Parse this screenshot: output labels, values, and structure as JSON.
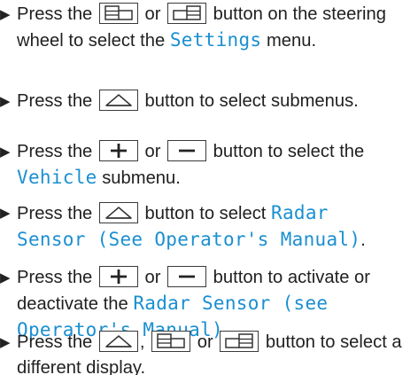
{
  "bullet_glyph": "▶",
  "accent_color": "#1a8fd1",
  "steps": [
    [
      {
        "t": "text",
        "v": "Press the "
      },
      {
        "t": "key",
        "icon": "display-back-icon"
      },
      {
        "t": "text",
        "v": " or "
      },
      {
        "t": "key",
        "icon": "display-forward-icon"
      },
      {
        "t": "text",
        "v": " button on the steering wheel to select the "
      },
      {
        "t": "mono",
        "v": "Settings"
      },
      {
        "t": "text",
        "v": " menu."
      }
    ],
    [
      {
        "t": "text",
        "v": "Press the "
      },
      {
        "t": "key",
        "icon": "up-arrow-icon"
      },
      {
        "t": "text",
        "v": " button to select submenus."
      }
    ],
    [
      {
        "t": "text",
        "v": "Press the "
      },
      {
        "t": "key",
        "icon": "plus-icon"
      },
      {
        "t": "text",
        "v": " or "
      },
      {
        "t": "key",
        "icon": "minus-icon"
      },
      {
        "t": "text",
        "v": " button to select the "
      },
      {
        "t": "mono",
        "v": "Vehicle"
      },
      {
        "t": "text",
        "v": " submenu."
      }
    ],
    [
      {
        "t": "text",
        "v": "Press the "
      },
      {
        "t": "key",
        "icon": "up-arrow-icon"
      },
      {
        "t": "text",
        "v": " button to select "
      },
      {
        "t": "mono",
        "v": "Radar"
      },
      {
        "t": "text",
        "v": " "
      },
      {
        "t": "mono",
        "v": "Sensor (See Operator's Manual)"
      },
      {
        "t": "text",
        "v": "."
      }
    ],
    [
      {
        "t": "text",
        "v": "Press the "
      },
      {
        "t": "key",
        "icon": "plus-icon"
      },
      {
        "t": "text",
        "v": " or "
      },
      {
        "t": "key",
        "icon": "minus-icon"
      },
      {
        "t": "text",
        "v": " button to activate or deactivate the "
      },
      {
        "t": "mono",
        "v": "Radar Sensor (see"
      },
      {
        "t": "text",
        "v": " "
      },
      {
        "t": "mono",
        "v": "Operator's Manual)"
      },
      {
        "t": "text",
        "v": "."
      }
    ],
    [
      {
        "t": "text",
        "v": "Press the "
      },
      {
        "t": "key",
        "icon": "up-arrow-icon"
      },
      {
        "t": "text",
        "v": ", "
      },
      {
        "t": "key",
        "icon": "display-back-icon"
      },
      {
        "t": "text",
        "v": " or "
      },
      {
        "t": "key",
        "icon": "display-forward-icon"
      },
      {
        "t": "text",
        "v": " button to select a different display."
      }
    ]
  ]
}
